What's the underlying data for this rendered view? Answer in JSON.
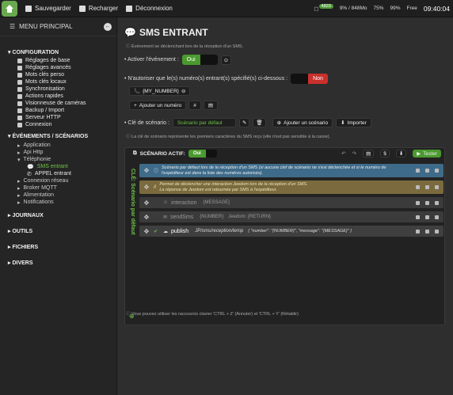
{
  "topbar": {
    "save": "Sauvegarder",
    "reload": "Recharger",
    "logout": "Déconnexion",
    "badge": "4829",
    "mem": "9% / 848Mo",
    "wifi": "75%",
    "battery": "99%",
    "free": "Free",
    "clock": "09:40:04"
  },
  "sidebar": {
    "title": "MENU PRINCIPAL",
    "config": {
      "title": "CONFIGURATION",
      "items": [
        "Réglages de base",
        "Réglages avancés",
        "Mots clés perso",
        "Mots clés locaux",
        "Synchronisation",
        "Actions rapides",
        "Visionneuse de caméras",
        "Backup / Import",
        "Serveur HTTP",
        "Connexion"
      ]
    },
    "events": {
      "title": "ÉVÉNEMENTS / SCÉNARIOS",
      "items": [
        "Application",
        "Api Http",
        "Téléphonie",
        "SMS entrant",
        "APPEL entrant",
        "Connexion réseau",
        "Broker MQTT",
        "Alimentation",
        "Notifications"
      ]
    },
    "journals": "JOURNAUX",
    "tools": "OUTILS",
    "files": "FICHIERS",
    "misc": "DIVERS"
  },
  "main": {
    "title": "SMS ENTRANT",
    "subtitle": "Événement se déclenchant lors de la réception d'un SMS.",
    "activate_label": "Activer l'événement :",
    "oui": "Oui",
    "restrict_label": "N'autoriser que le(s) numéro(s) entrant(s) spécifié(s) ci-dessous :",
    "non": "Non",
    "number": "{MY_NUMBER}",
    "add_number": "Ajouter un numéro",
    "key_label": "Clé de scénario :",
    "key_value": "Scénario par défaut",
    "add_scenario": "Ajouter un scénario",
    "import": "Importer",
    "key_hint": "La clé de scénario représente les premiers caractères du SMS reçu (elle n'est pas sensible à la casse).",
    "scen_active": "SCÉNARIO ACTIF:",
    "test": "Tester",
    "side_label": "CLÉ: Scénario par défaut",
    "blocks": {
      "b1": "Scénario par défaut lors de la réception d'un SMS (si aucune clef de scénario ne s'est déclenchée et si le numéro de l'expéditeur est dans la liste des numéros autorisés).",
      "b2a": "Permet de déclencher une interaction Jeedom lors de la réception d'un SMS.",
      "b2b": "La réponse de Jeedom est retournée par SMS à l'expéditeur.",
      "b3": "interaction",
      "b3p": "{MESSAGE}",
      "b4": "sendSms",
      "b4p1": "{NUMBER}",
      "b4p2": "Jeedom: {RETURN}",
      "b5": "publish",
      "b5p": "JP/sms/reception/temp",
      "b5j": "{ \"number\": \"{NUMBER}\", \"message\": \"{MESSAGE}\" }"
    },
    "footer": "Vous pouvez utiliser les raccourcis clavier 'CTRL + Z' (Annuler) et 'CTRL + Y' (Rétablir)"
  }
}
